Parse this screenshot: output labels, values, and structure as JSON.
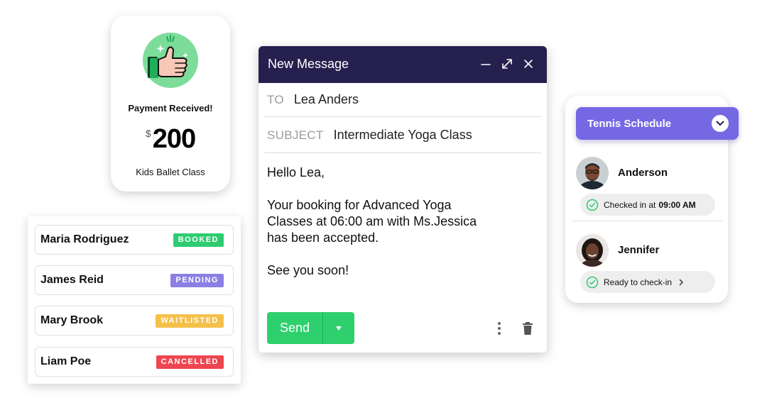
{
  "payment": {
    "title": "Payment Received!",
    "currency": "$",
    "amount": "200",
    "class_name": "Kids Ballet Class",
    "icon": "thumbs-up-money-icon"
  },
  "bookings": [
    {
      "name": "Maria Rodriguez",
      "status": "BOOKED",
      "color": "#2ecc71"
    },
    {
      "name": "James Reid",
      "status": "PENDING",
      "color": "#8b7fe3"
    },
    {
      "name": "Mary Brook",
      "status": "WAITLISTED",
      "color": "#f5c04a"
    },
    {
      "name": "Liam Poe",
      "status": "CANCELLED",
      "color": "#ef4550"
    }
  ],
  "message": {
    "window_title": "New Message",
    "to_label": "TO",
    "to_value": "Lea Anders",
    "subject_label": "SUBJECT",
    "subject_value": "Intermediate Yoga Class",
    "greeting": "Hello Lea,",
    "body_line1": "Your booking for Advanced Yoga",
    "body_line2": "Classes at 06:00 am with Ms.Jessica",
    "body_line3": "has been accepted.",
    "closing": "See you soon!",
    "send_label": "Send",
    "icons": [
      "minimize-icon",
      "expand-icon",
      "close-icon",
      "dropdown-arrow-icon",
      "more-vertical-icon",
      "trash-icon"
    ],
    "header_color": "#26204e",
    "send_color": "#2ed06e"
  },
  "tennis": {
    "title": "Tennis Schedule",
    "header_color": "#7568e3",
    "people": [
      {
        "name": "Anderson",
        "status_text": "Checked in at",
        "status_time": "09:00 AM"
      },
      {
        "name": "Jennifer",
        "status_text": "Ready to check-in",
        "status_time": ""
      }
    ]
  }
}
